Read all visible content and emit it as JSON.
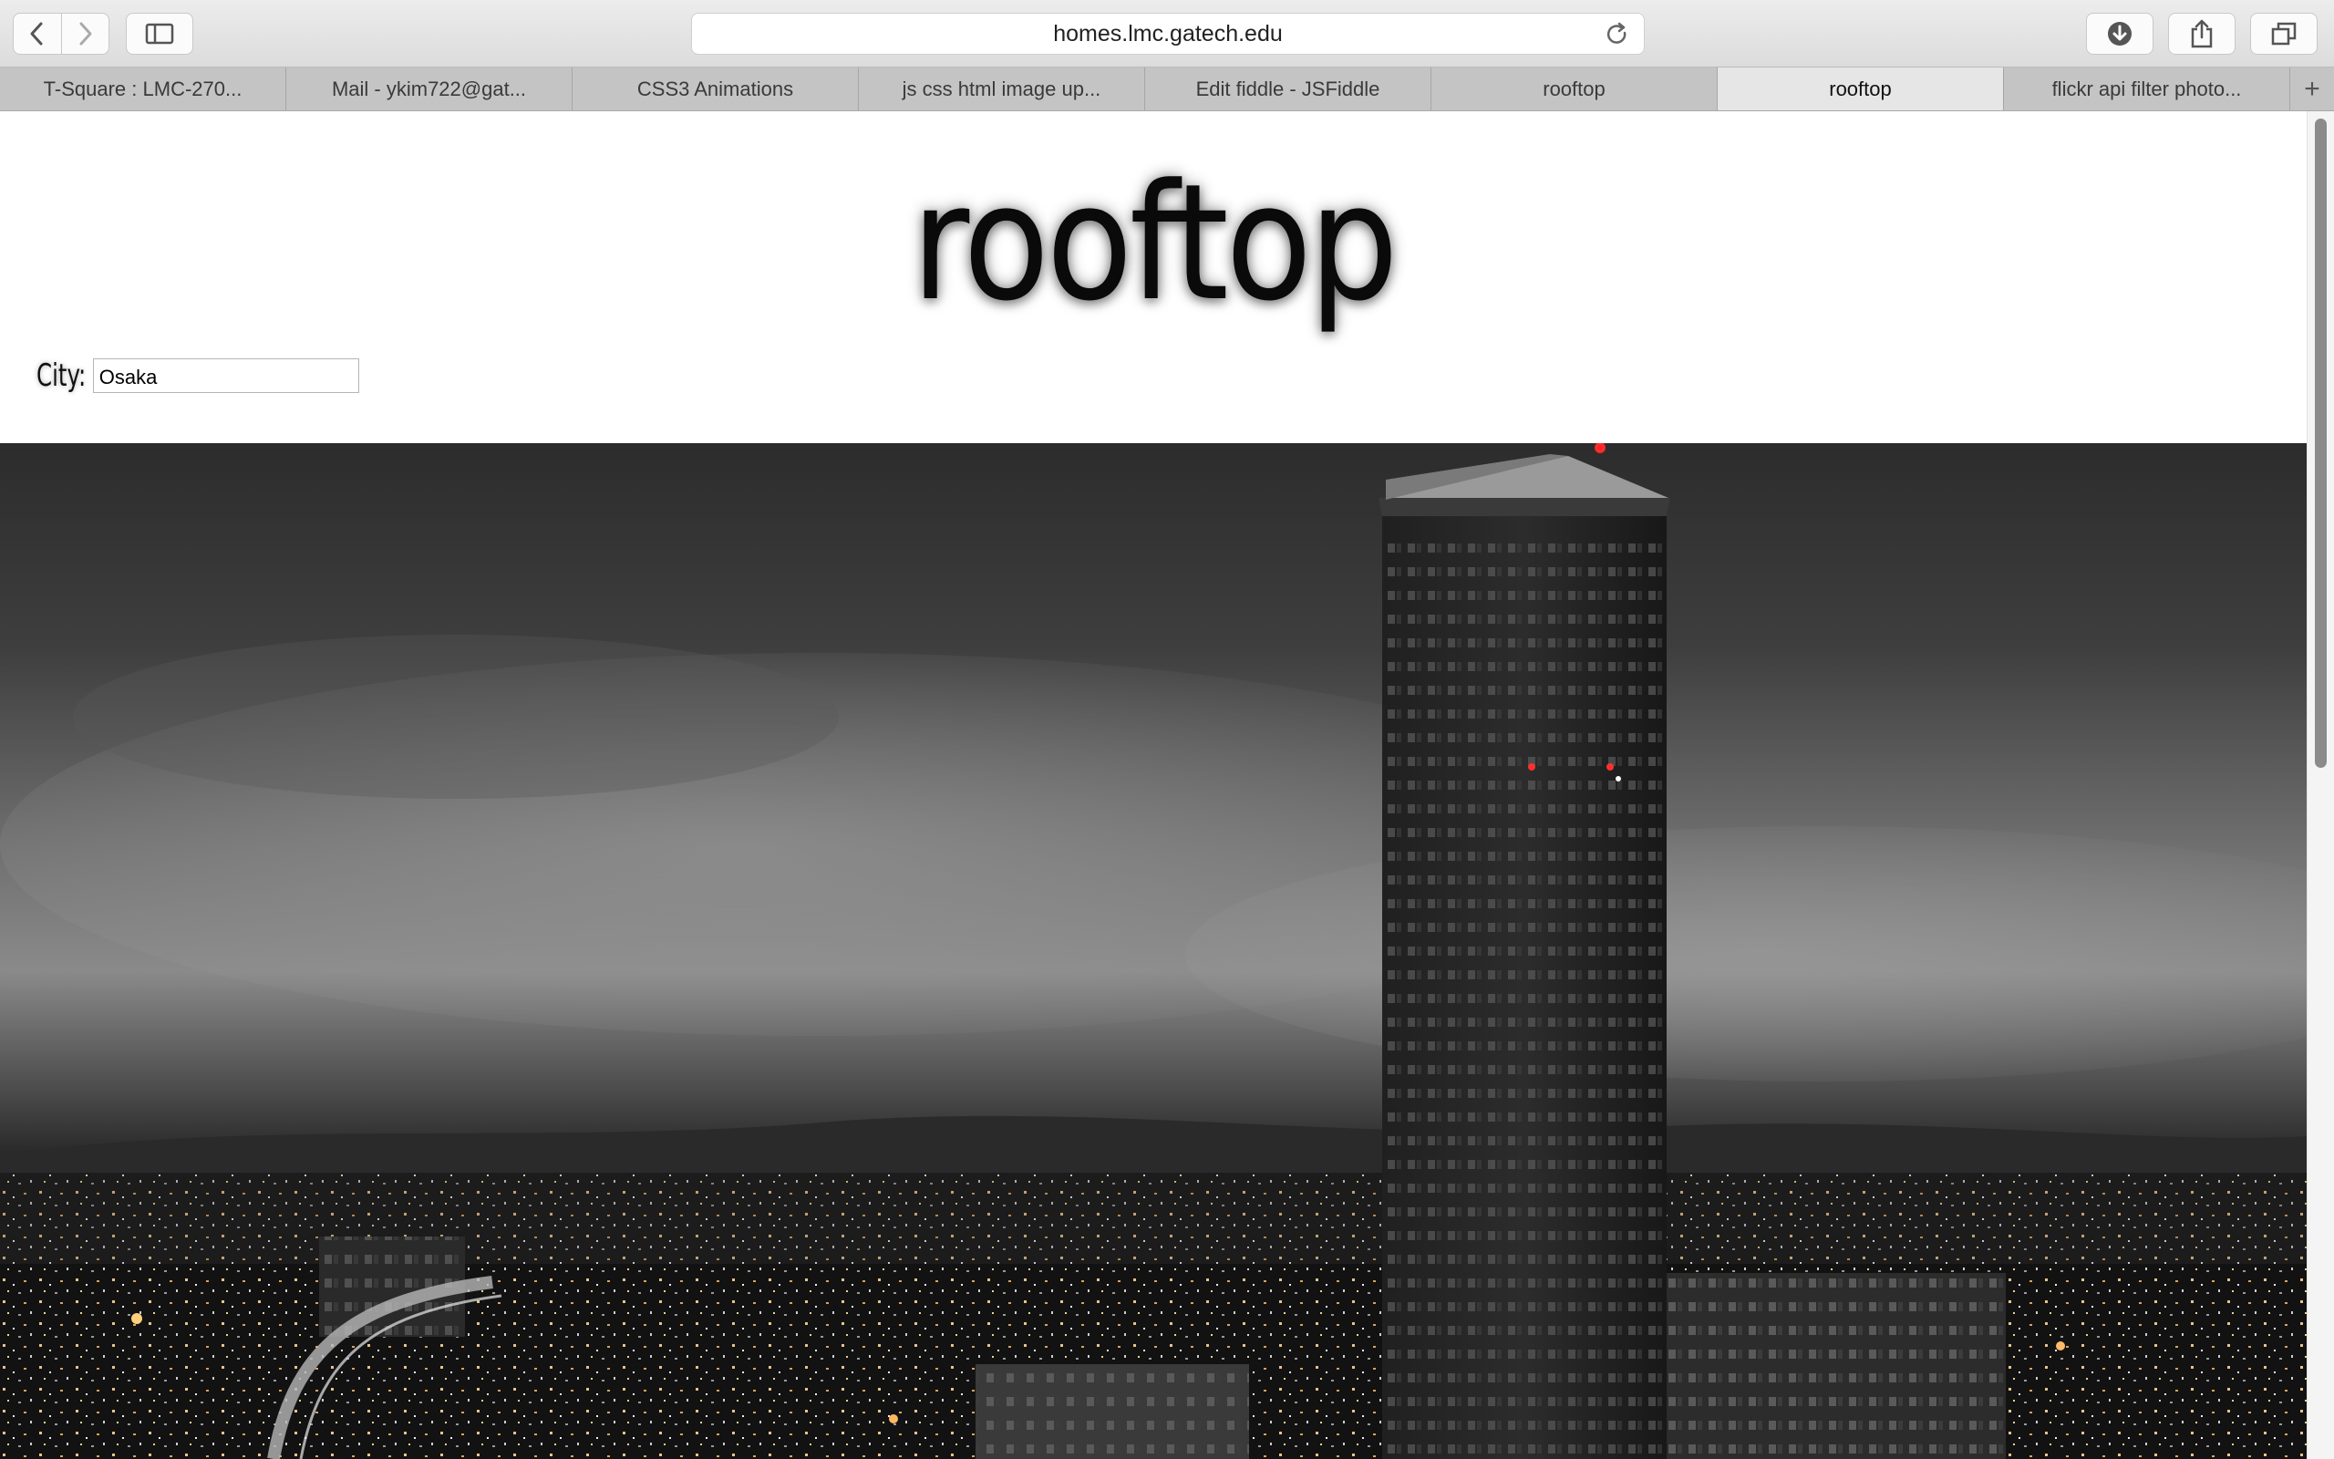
{
  "browser": {
    "url": "homes.lmc.gatech.edu",
    "tabs": [
      {
        "label": "T-Square : LMC-270...",
        "active": false
      },
      {
        "label": "Mail - ykim722@gat...",
        "active": false
      },
      {
        "label": "CSS3 Animations",
        "active": false
      },
      {
        "label": "js css html image up...",
        "active": false
      },
      {
        "label": "Edit fiddle - JSFiddle",
        "active": false
      },
      {
        "label": "rooftop",
        "active": false
      },
      {
        "label": "rooftop",
        "active": true
      },
      {
        "label": "flickr api filter photo...",
        "active": false
      }
    ],
    "new_tab_symbol": "+",
    "icons": {
      "back": "chevron-left-icon",
      "forward": "chevron-right-icon",
      "sidebar": "sidebar-icon",
      "reload": "reload-icon",
      "downloads": "download-icon",
      "share": "share-icon",
      "tabs": "tab-overview-icon"
    }
  },
  "page": {
    "title": "rooftop",
    "city_label": "City:",
    "city_value": "Osaka",
    "hero_image": "night-city-skyline-photo"
  }
}
